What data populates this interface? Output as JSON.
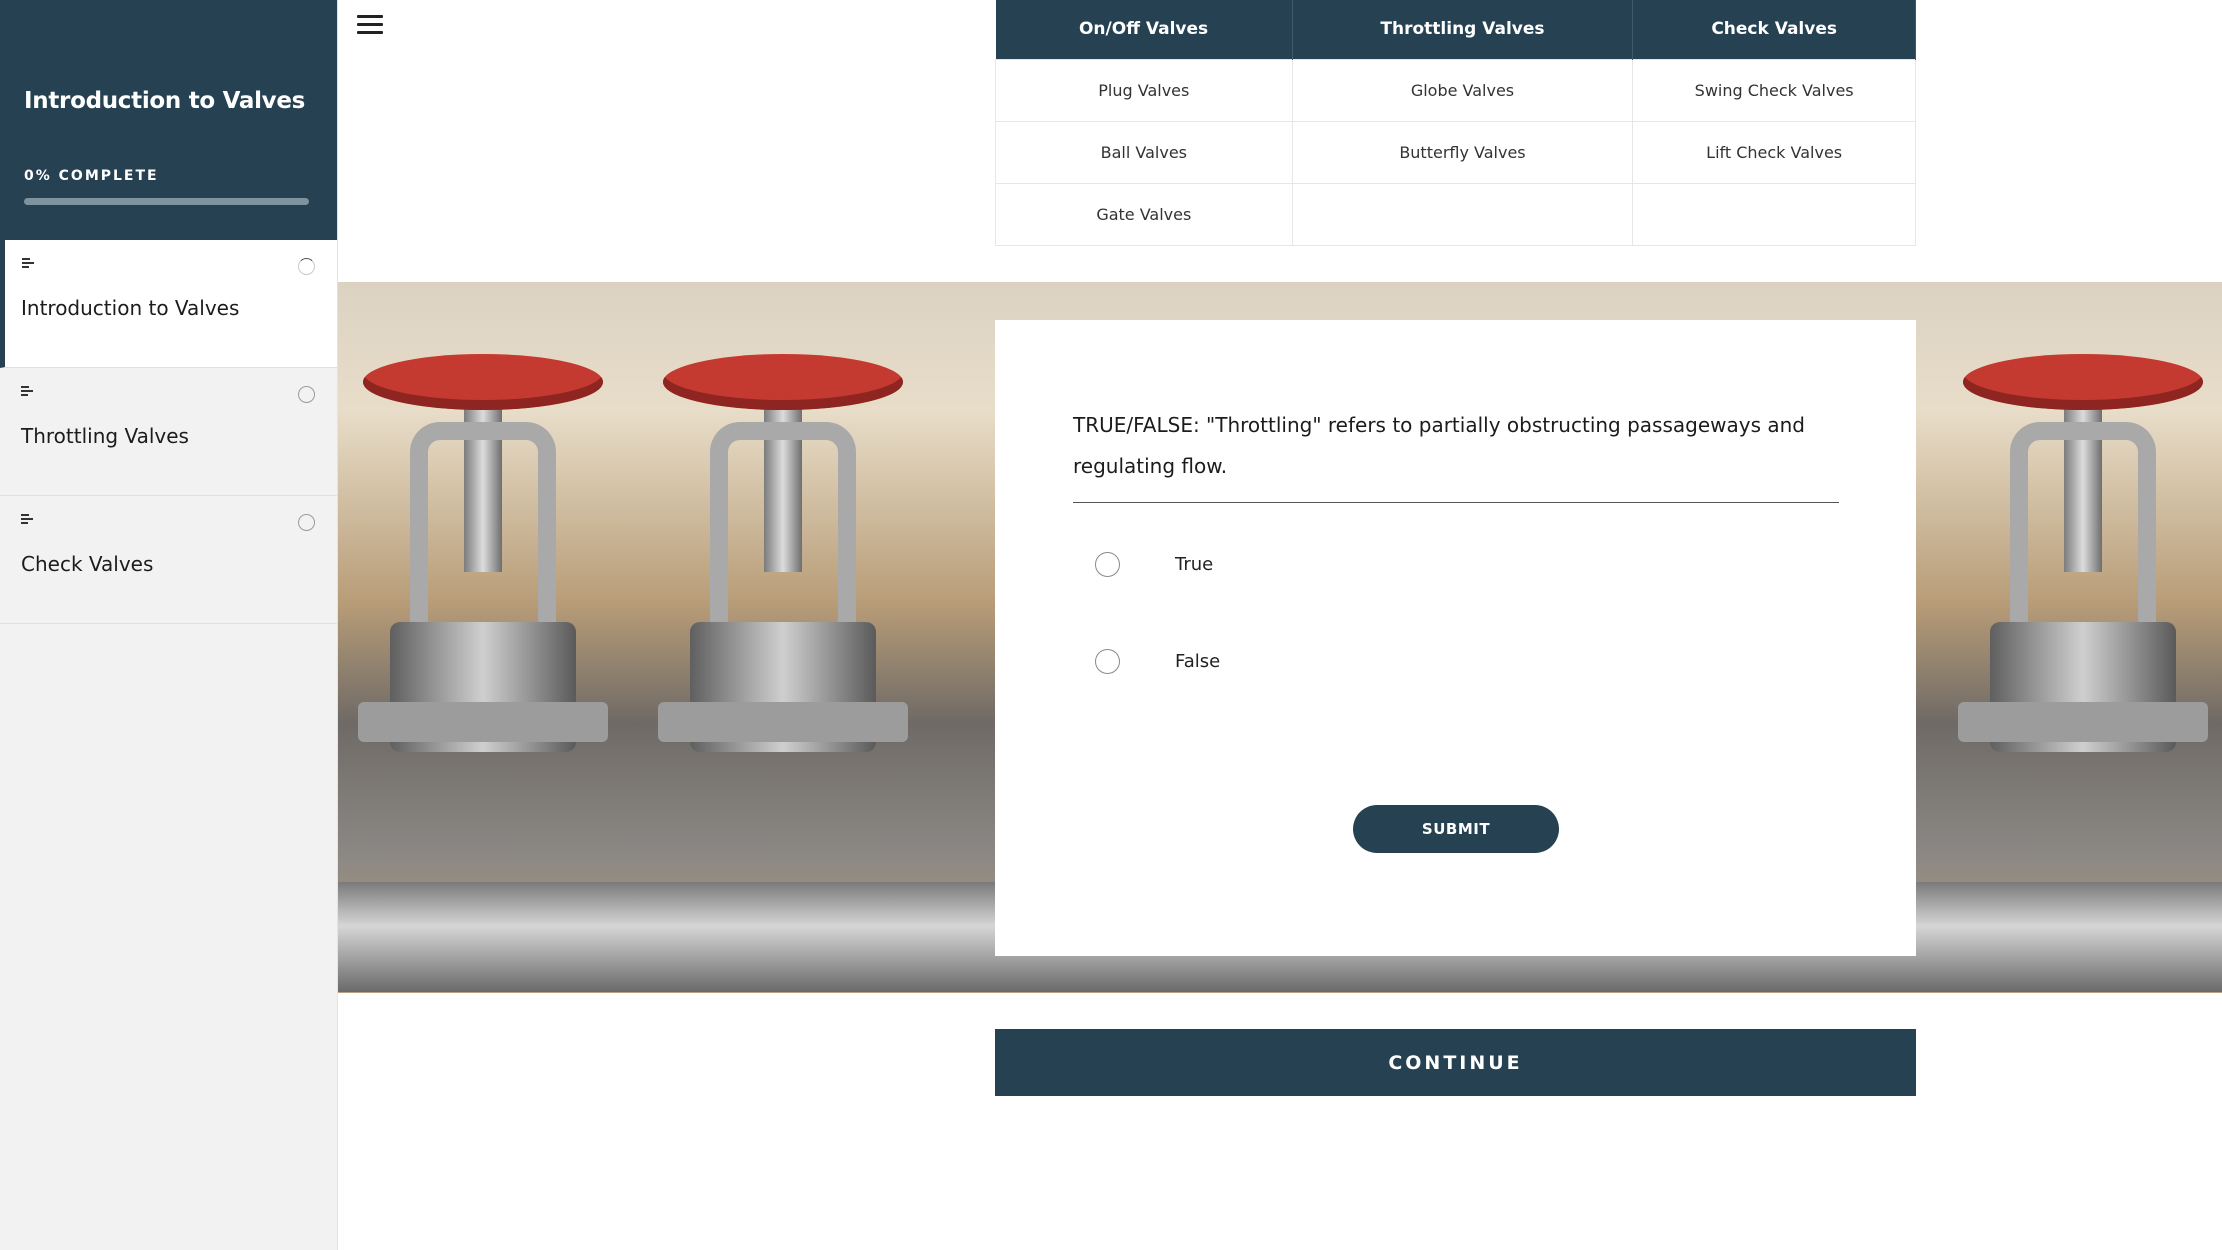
{
  "sidebar": {
    "course_title": "Introduction to Valves",
    "progress_label": "0% COMPLETE",
    "progress_fraction": 0.0,
    "lessons": [
      {
        "label": "Introduction to Valves",
        "status": "in-progress",
        "active": true
      },
      {
        "label": "Throttling Valves",
        "status": "not-started",
        "active": false
      },
      {
        "label": "Check Valves",
        "status": "not-started",
        "active": false
      }
    ]
  },
  "table": {
    "headers": [
      "On/Off Valves",
      "Throttling Valves",
      "Check Valves"
    ],
    "rows": [
      [
        "Plug Valves",
        "Globe Valves",
        "Swing Check Valves"
      ],
      [
        "Ball Valves",
        "Butterfly Valves",
        "Lift Check Valves"
      ],
      [
        "Gate Valves",
        "",
        ""
      ]
    ]
  },
  "quiz": {
    "question": "TRUE/FALSE: \"Throttling\" refers to partially obstructing passageways and regulating flow.",
    "options": [
      "True",
      "False"
    ],
    "submit_label": "SUBMIT"
  },
  "continue_label": "CONTINUE",
  "colors": {
    "primary": "#254152",
    "valve_wheel": "#c43a30"
  }
}
